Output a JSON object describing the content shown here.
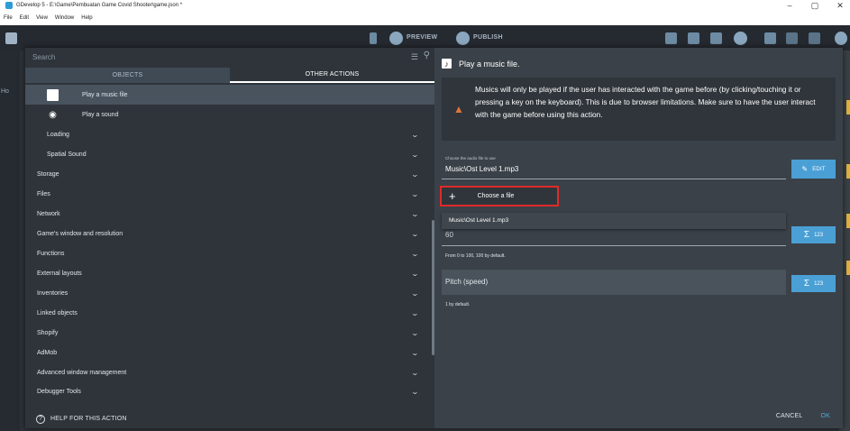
{
  "window": {
    "title": "GDevelop 5 - E:\\Game\\Pembuatan Game Covid Shooter\\game.json *",
    "minimize": "–",
    "maximize": "▢",
    "close": "✕"
  },
  "menubar": {
    "items": [
      "File",
      "Edit",
      "View",
      "Window",
      "Help"
    ]
  },
  "toolbar": {
    "preview_label": "PREVIEW",
    "publish_label": "PUBLISH"
  },
  "side": {
    "tab_label": "Ho"
  },
  "search": {
    "placeholder": "Search"
  },
  "tabs": {
    "objects": "OBJECTS",
    "other_actions": "OTHER ACTIONS"
  },
  "actions_list": {
    "play_music": "Play a music file",
    "play_sound": "Play a sound"
  },
  "categories": [
    "Loading",
    "Spatial Sound",
    "Storage",
    "Files",
    "Network",
    "Game's window and resolution",
    "Functions",
    "External layouts",
    "Inventories",
    "Linked objects",
    "Shopify",
    "AdMob",
    "Advanced window management",
    "Debugger Tools"
  ],
  "footer": {
    "help": "HELP FOR THIS ACTION",
    "cancel": "CANCEL",
    "ok": "OK"
  },
  "action_panel": {
    "title": "Play a music file.",
    "warning": "Musics will only be played if the user has interacted with the game before (by clicking/touching it or pressing a key on the keyboard). This is due to browser limitations. Make sure to have the user interact with the game before using this action.",
    "audio_label": "Choose the audio file to use",
    "audio_value": "Music\\Ost Level 1.mp3",
    "edit_label": "EDIT",
    "choose_file_label": "Choose a file",
    "suggestion": "Music\\Ost Level 1.mp3",
    "volume_value": "60",
    "volume_hint": "From 0 to 100, 100 by default.",
    "pitch_label": "Pitch (speed)",
    "pitch_hint": "1 by default.",
    "expr_label": "123"
  },
  "colors": {
    "accent": "#4aa0d5",
    "highlight": "#e02a2a",
    "warning": "#e1733d"
  }
}
